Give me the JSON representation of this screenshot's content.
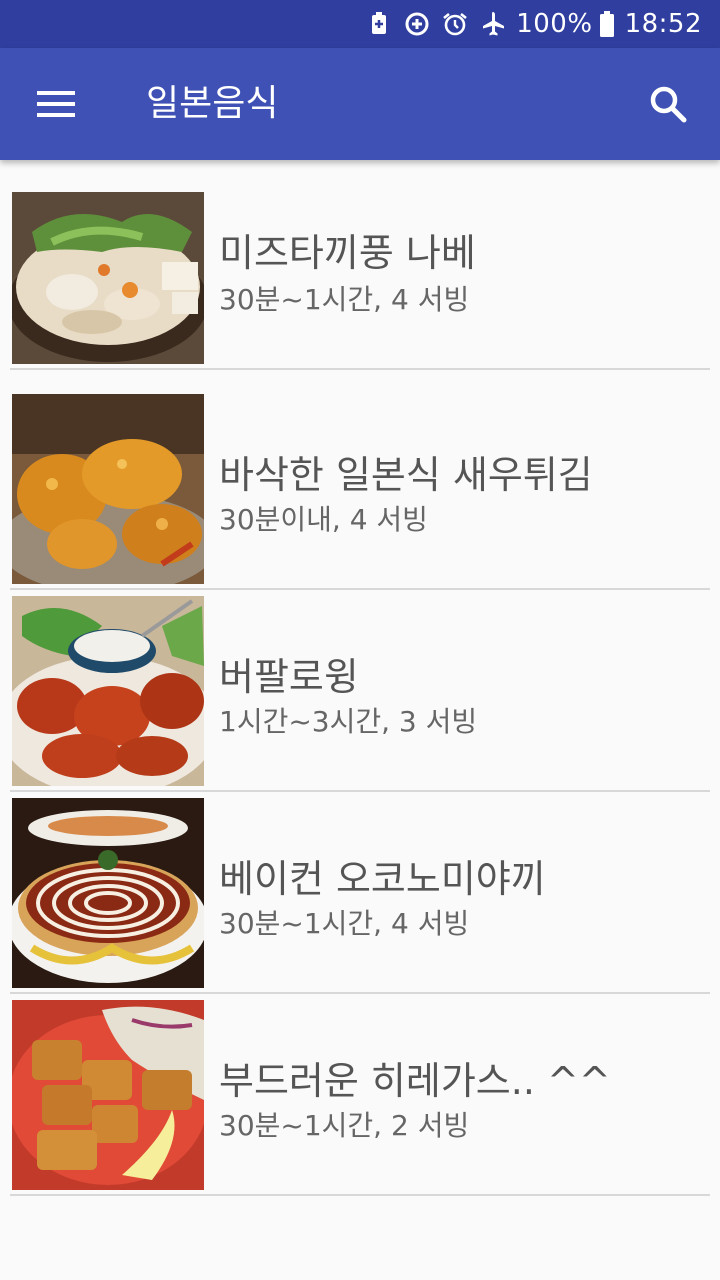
{
  "status_bar": {
    "battery_percent": "100%",
    "time": "18:52",
    "icons": [
      "battery-saver-icon",
      "data-saver-icon",
      "alarm-icon",
      "airplane-mode-icon",
      "battery-icon"
    ]
  },
  "app_bar": {
    "title": "일본음식",
    "menu_icon": "menu-icon",
    "search_icon": "search-icon"
  },
  "recipes": [
    {
      "title": "미즈타끼풍 나베",
      "meta": "30분~1시간, 4 서빙",
      "image": "hot-pot-photo"
    },
    {
      "title": "바삭한 일본식 새우튀김",
      "meta": "30분이내, 4 서빙",
      "image": "fried-shrimp-photo"
    },
    {
      "title": "버팔로윙",
      "meta": "1시간~3시간, 3 서빙",
      "image": "buffalo-wings-photo"
    },
    {
      "title": "베이컨 오코노미야끼",
      "meta": "30분~1시간, 4 서빙",
      "image": "okonomiyaki-photo"
    },
    {
      "title": "부드러운 히레가스.. ^^",
      "meta": "30분~1시간, 2 서빙",
      "image": "katsu-photo"
    }
  ],
  "colors": {
    "primary": "#3f51b5",
    "primary_dark": "#303f9f",
    "background": "#fafafa"
  }
}
